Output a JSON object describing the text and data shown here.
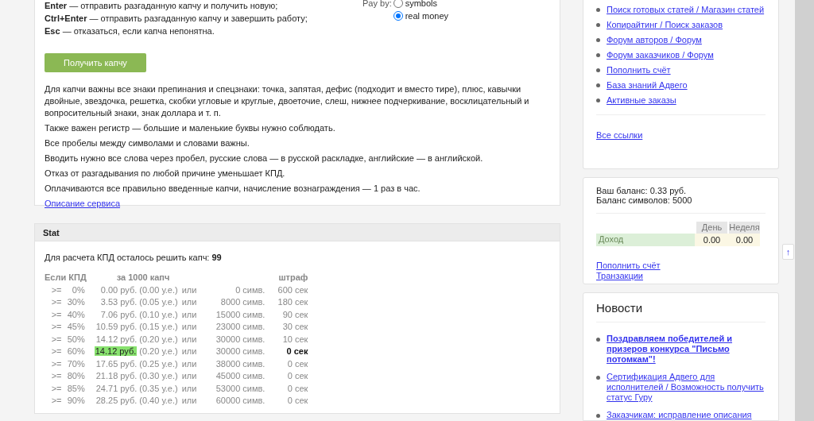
{
  "instructions": [
    "**Enter** — отправить разгаданную капчу и получить новую;",
    "**Ctrl+Enter** — отправить разгаданную капчу и завершить работу;",
    "**Esc** — отказаться, если капча непонятна."
  ],
  "pay_by": {
    "label": "Pay by:",
    "options": [
      {
        "label": "symbols",
        "selected": false
      },
      {
        "label": "real money",
        "selected": true
      }
    ]
  },
  "get_captcha_button": "Получить капчу",
  "rules": [
    "Для капчи важны все знаки препинания и спецзнаки: точка, запятая, дефис (подходит и вместо тире), плюс, кавычки двойные, звездочка, решетка, скобки угловые и круглые, двоеточие, слеш, нижнее подчеркивание, восклицательный и вопросительный знаки, знак доллара и т. п.",
    "Также важен регистр — большие и маленькие буквы нужно соблюдать.",
    "Все пробелы между символами и словами важны.",
    "Вводить нужно все слова через пробел, русские слова — в русской раскладке, английские — в английской.",
    "Отказ от разгадывания по любой причине уменьшает КПД.",
    "Оплачиваются все правильно введенные капчи, начисление вознаграждения — 1 раз в час."
  ],
  "service_link": "Описание сервиса",
  "stat": {
    "title": "Stat",
    "remaining_label": "Для расчета КПД осталось решить капч:",
    "remaining": "99",
    "columns": [
      "Если КПД",
      "за 1000 капч",
      "штраф"
    ],
    "rows": [
      {
        "op": ">=",
        "kpd": "0%",
        "rub": "0.00 руб.",
        "ue": "(0.00 у.е.)",
        "or": "или",
        "symbols": "0 симв.",
        "penalty": "600 сек",
        "current": false
      },
      {
        "op": ">=",
        "kpd": "30%",
        "rub": "3.53 руб.",
        "ue": "(0.05 у.е.)",
        "or": "или",
        "symbols": "8000 симв.",
        "penalty": "180 сек",
        "current": false
      },
      {
        "op": ">=",
        "kpd": "40%",
        "rub": "7.06 руб.",
        "ue": "(0.10 у.е.)",
        "or": "или",
        "symbols": "15000 симв.",
        "penalty": "90 сек",
        "current": false
      },
      {
        "op": ">=",
        "kpd": "45%",
        "rub": "10.59 руб.",
        "ue": "(0.15 у.е.)",
        "or": "или",
        "symbols": "23000 симв.",
        "penalty": "30 сек",
        "current": false
      },
      {
        "op": ">=",
        "kpd": "50%",
        "rub": "14.12 руб.",
        "ue": "(0.20 у.е.)",
        "or": "или",
        "symbols": "30000 симв.",
        "penalty": "10 сек",
        "current": false
      },
      {
        "op": ">=",
        "kpd": "60%",
        "rub": "14.12 руб.",
        "ue": "(0.20 у.е.)",
        "or": "или",
        "symbols": "30000 симв.",
        "penalty": "0 сек",
        "current": true
      },
      {
        "op": ">=",
        "kpd": "70%",
        "rub": "17.65 руб.",
        "ue": "(0.25 у.е.)",
        "or": "или",
        "symbols": "38000 симв.",
        "penalty": "0 сек",
        "current": false
      },
      {
        "op": ">=",
        "kpd": "80%",
        "rub": "21.18 руб.",
        "ue": "(0.30 у.е.)",
        "or": "или",
        "symbols": "45000 симв.",
        "penalty": "0 сек",
        "current": false
      },
      {
        "op": ">=",
        "kpd": "85%",
        "rub": "24.71 руб.",
        "ue": "(0.35 у.е.)",
        "or": "или",
        "symbols": "53000 симв.",
        "penalty": "0 сек",
        "current": false
      },
      {
        "op": ">=",
        "kpd": "90%",
        "rub": "28.25 руб.",
        "ue": "(0.40 у.е.)",
        "or": "или",
        "symbols": "60000 симв.",
        "penalty": "0 сек",
        "current": false
      }
    ]
  },
  "links": {
    "items": [
      "Поиск готовых статей / Магазин статей",
      "Копирайтинг / Поиск заказов",
      "Форум авторов / Форум",
      "Форум заказчиков / Форум",
      "Пополнить счёт",
      "База знаний Адвего",
      "Активные заказы"
    ],
    "all_links": "Все ссылки"
  },
  "balance": {
    "lines": [
      "Ваш баланс: 0.33 руб.",
      "Баланс символов: 5000"
    ],
    "table": {
      "columns": [
        "День",
        "Неделя"
      ],
      "rows": [
        {
          "label": "Доход",
          "values": [
            "0.00",
            "0.00"
          ]
        }
      ]
    },
    "links": [
      "Пополнить счёт",
      "Транзакции"
    ]
  },
  "scroll_top": "↑",
  "news": {
    "title": "Новости",
    "items": [
      {
        "text": "Поздравляем победителей и призеров конкурса \"Письмо потомкам\"!",
        "bold": true
      },
      {
        "text": "Сертификация Адвего для исполнителей / Возможность получить статус Гуру",
        "bold": false
      },
      {
        "text": "Заказчикам: исправление описания",
        "bold": false
      }
    ]
  }
}
